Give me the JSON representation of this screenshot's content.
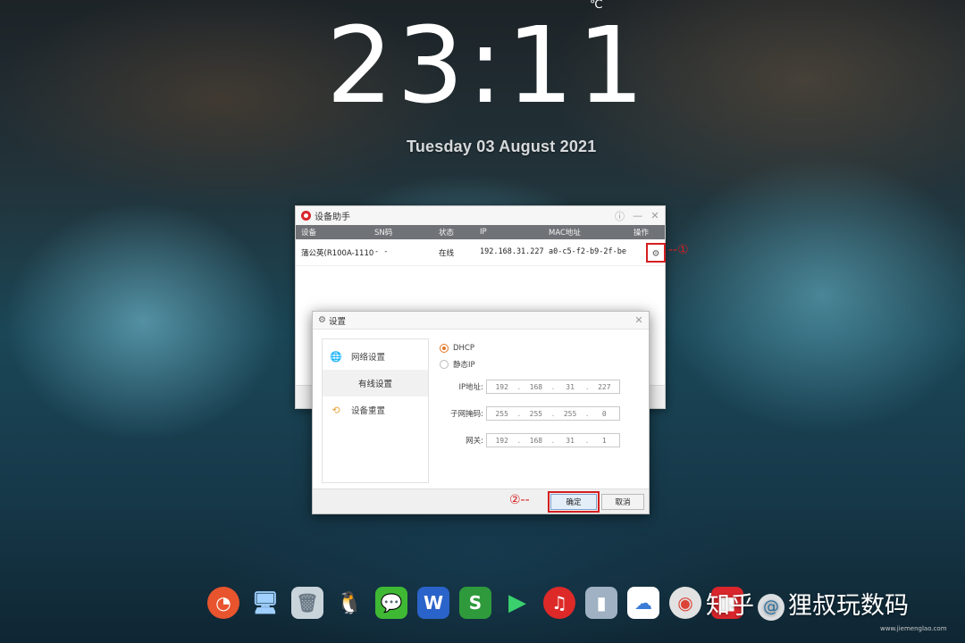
{
  "desktop": {
    "temp_unit": "℃",
    "clock": "23:11",
    "date": "Tuesday  03 August 2021"
  },
  "main_window": {
    "title": "设备助手",
    "controls": [
      "ⓘ",
      "—",
      "✕"
    ],
    "columns": [
      "设备",
      "SN码",
      "状态",
      "IP",
      "MAC地址",
      "操作"
    ],
    "row": {
      "device": "蒲公英(R100A-1110",
      "sn": "- -",
      "status": "在线",
      "ip": "192.168.31.227",
      "mac": "a0-c5-f2-b9-2f-be"
    },
    "callout": "--①"
  },
  "settings_window": {
    "title": "设置",
    "close": "✕",
    "nav": {
      "network": "网络设置",
      "wired": "有线设置",
      "reset": "设备重置"
    },
    "dhcp_label": "DHCP",
    "static_label": "静态IP",
    "selected_mode": "DHCP",
    "fields": {
      "ip_label": "IP地址:",
      "ip": [
        "192",
        "168",
        "31",
        "227"
      ],
      "mask_label": "子网掩码:",
      "mask": [
        "255",
        "255",
        "255",
        "0"
      ],
      "gateway_label": "网关:",
      "gateway": [
        "192",
        "168",
        "31",
        "1"
      ]
    },
    "ok_label": "确定",
    "cancel_label": "取消",
    "callout": "②--"
  },
  "dock": {
    "icons": [
      "cloud-app-icon",
      "computer-icon",
      "recycle-bin-icon",
      "qq-icon",
      "wechat-icon",
      "wps-writer-icon",
      "wps-sheet-icon",
      "video-player-icon",
      "netease-music-icon",
      "battery-tool-icon",
      "baidu-netdisk-icon",
      "chrome-icon",
      "red-app-icon"
    ],
    "writer_glyph": "W",
    "sheet_glyph": "S"
  },
  "watermark": {
    "text_left": "知乎",
    "at": "@",
    "text_right": "狸叔玩数码",
    "url": "www.jiemenglao.com"
  }
}
